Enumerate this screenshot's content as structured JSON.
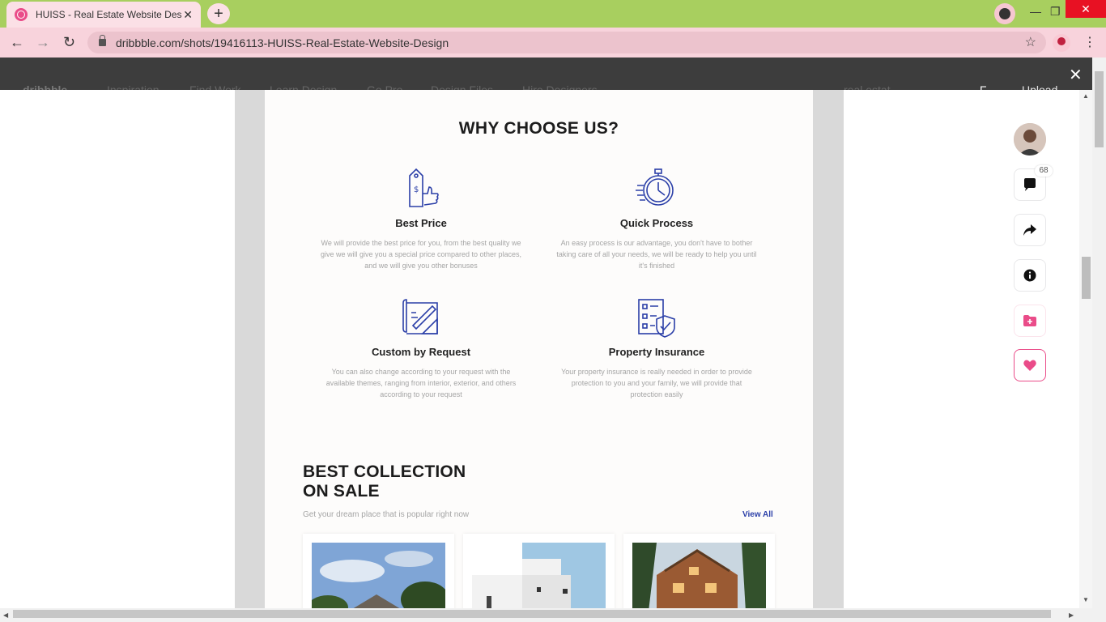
{
  "browser": {
    "tab_title": "HUISS - Real Estate Website Design",
    "tab_close": "✕",
    "new_tab": "+",
    "url": "dribbble.com/shots/19416113-HUISS-Real-Estate-Website-Design",
    "back": "←",
    "forward": "→",
    "reload": "↻",
    "bookmark": "☆",
    "menu": "⋮",
    "minimize": "—",
    "restore": "❐",
    "close": "✕"
  },
  "background_nav": {
    "logo": "dribbble",
    "items": [
      "Inspiration",
      "Find Work",
      "Learn Design",
      "Go Pro",
      "Design Files",
      "Hire Designers"
    ],
    "search": "real estat",
    "upload": "Upload",
    "avatar_initial": "F"
  },
  "modal": {
    "close": "✕"
  },
  "shot": {
    "why_title": "WHY CHOOSE US?",
    "features": [
      {
        "name": "Best Price",
        "icon": "price-tag-thumbs-up-icon",
        "desc": "We will provide the best price for you, from the best quality we give we will give you a special price compared to other places, and we will give you other bonuses"
      },
      {
        "name": "Quick Process",
        "icon": "stopwatch-icon",
        "desc": "An easy process is our advantage, you don't have to bother taking care of all your needs, we will be ready to help you until it's finished"
      },
      {
        "name": "Custom by Request",
        "icon": "blueprint-pencil-icon",
        "desc": "You can also change according to your request with the available themes, ranging from interior, exterior, and others according to your request"
      },
      {
        "name": "Property Insurance",
        "icon": "checklist-shield-icon",
        "desc": "Your property insurance is really needed in order to provide protection to you and your family, we will provide that protection easily"
      }
    ],
    "collection_title_line1": "BEST COLLECTION",
    "collection_title_line2": "ON SALE",
    "collection_subtitle": "Get your dream place that is popular right now",
    "view_all": "View All",
    "accent_color": "#2b3fa8"
  },
  "actions": {
    "comment_count": "68",
    "items": [
      "comment-icon",
      "share-icon",
      "info-icon",
      "add-to-collection-icon",
      "heart-icon"
    ]
  }
}
